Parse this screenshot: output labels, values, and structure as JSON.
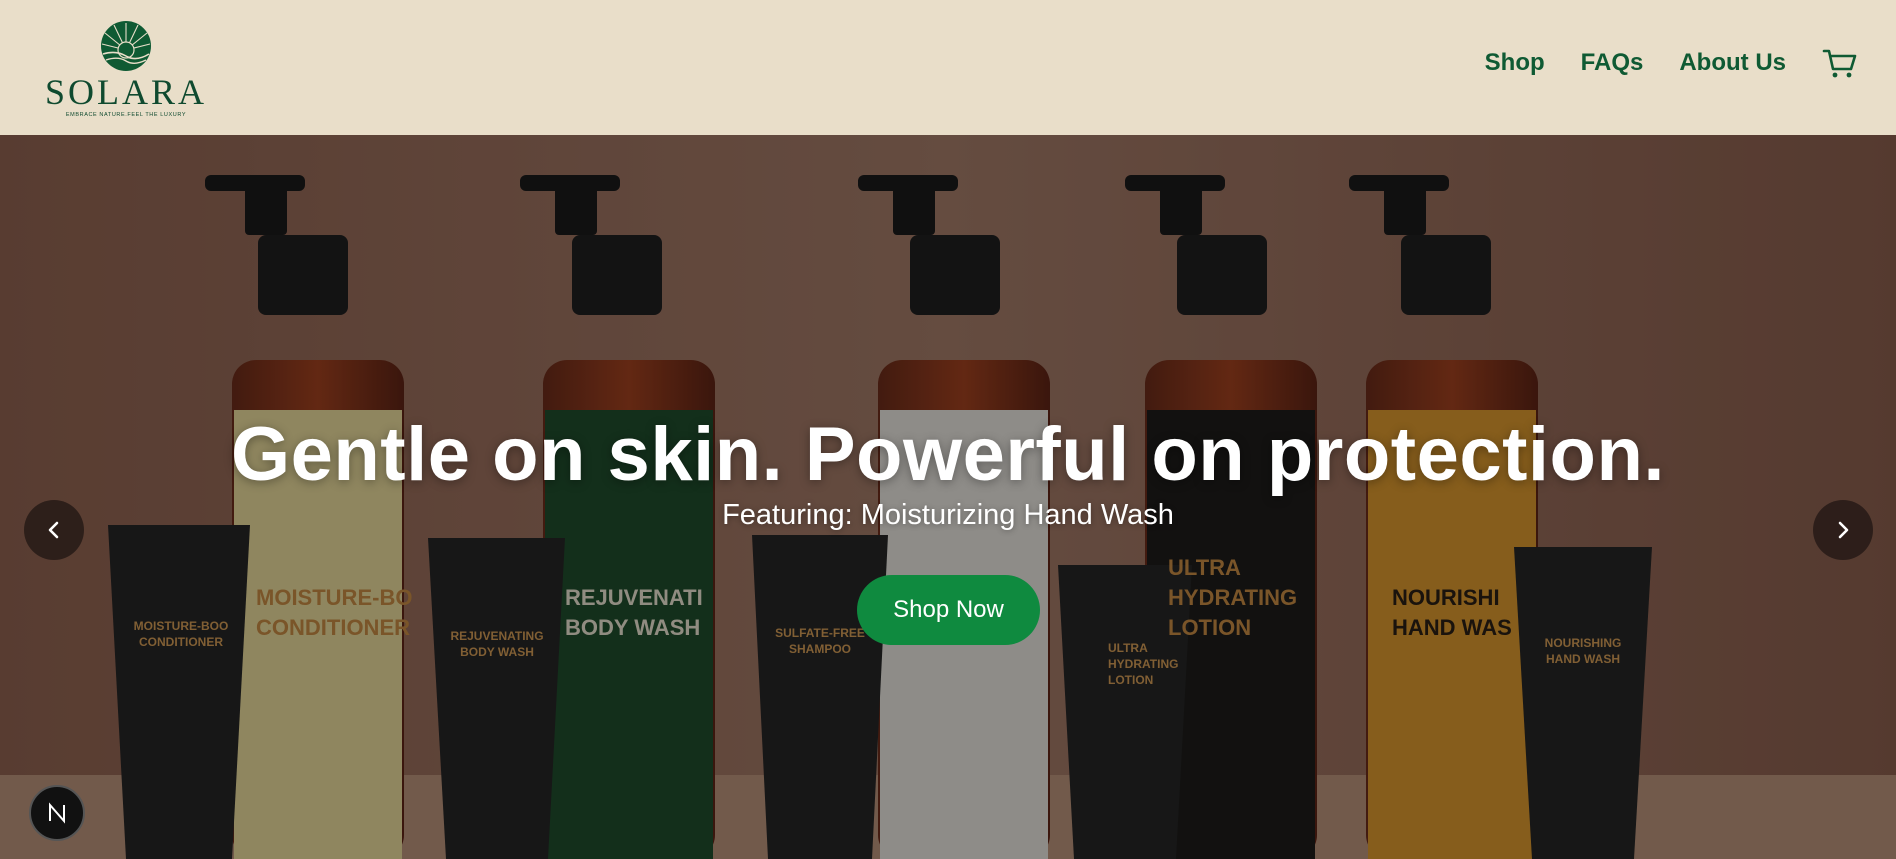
{
  "brand": {
    "name": "SOLARA",
    "tagline": "EMBRACE NATURE.FEEL THE LUXURY"
  },
  "nav": {
    "items": [
      {
        "label": "Shop"
      },
      {
        "label": "FAQs"
      },
      {
        "label": "About Us"
      }
    ],
    "cart_icon": "cart-icon"
  },
  "hero": {
    "title": "Gentle on skin. Powerful on protection.",
    "subtitle": "Featuring: Moisturizing Hand Wash",
    "cta_label": "Shop Now",
    "prev_icon": "chevron-left-icon",
    "next_icon": "chevron-right-icon",
    "products": [
      {
        "line1": "MOISTURE-BO",
        "line2": "CONDITIONER"
      },
      {
        "line1": "REJUVENATI",
        "line2": "BODY WASH"
      },
      {
        "line1": "",
        "line2": ""
      },
      {
        "line1": "ULTRA",
        "line2": "HYDRATING"
      },
      {
        "line1": "NOURISHI",
        "line2": "HAND WAS"
      }
    ],
    "tubes": [
      {
        "line1": "MOISTURE-BOO",
        "line2": "CONDITIONER"
      },
      {
        "line1": "REJUVENATING",
        "line2": "BODY WASH"
      },
      {
        "line1": "SULFATE-FREE",
        "line2": "SHAMPOO"
      },
      {
        "line1": "ULTRA",
        "line2": "HYDRATING"
      },
      {
        "line1": "NOURISHING",
        "line2": "HAND WASH"
      }
    ]
  },
  "dev_badge": {
    "letter": "N"
  },
  "colors": {
    "header_bg": "#e9dec9",
    "brand_green": "#0f4a2f",
    "nav_green": "#0f5a33",
    "cta_green": "#0f8a3f"
  }
}
